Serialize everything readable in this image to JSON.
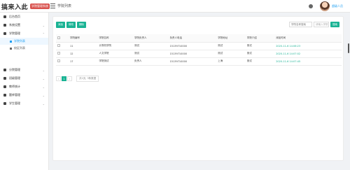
{
  "header": {
    "logo_text": "搞来入此",
    "logo_badge": "学院管理系统",
    "breadcrumb": "学院列表",
    "user_name": "超级人员"
  },
  "sidebar": {
    "items": [
      {
        "label": "后台首页",
        "icon": "home-icon"
      },
      {
        "label": "系统设置",
        "icon": "gear-icon"
      },
      {
        "label": "学院管理",
        "icon": "building-icon"
      },
      {
        "label": "分院管理",
        "icon": "sitemap-icon"
      },
      {
        "label": "班级管理",
        "icon": "users-icon"
      },
      {
        "label": "教师统计",
        "icon": "chart-icon"
      },
      {
        "label": "题库管理",
        "icon": "book-icon"
      },
      {
        "label": "学生管理",
        "icon": "student-icon"
      }
    ],
    "sub_items": [
      {
        "label": "学院列表"
      },
      {
        "label": "校区列表"
      }
    ]
  },
  "toolbar": {
    "add_label": "添加",
    "edit_label": "修改",
    "delete_label": "删除"
  },
  "search": {
    "select_value": "学院名称搜索",
    "input_placeholder": "请输入学院",
    "button_label": "搜索"
  },
  "table": {
    "columns": [
      "学院编号",
      "学院名称",
      "学院负责人",
      "负责人电话",
      "学院地址",
      "学院介绍",
      "添加时间"
    ],
    "rows": [
      [
        "11",
        "计算机学院",
        "测试",
        "15139710000",
        "测试",
        "测试",
        "2020-11-6 14:06:23"
      ],
      [
        "12",
        "人文学院",
        "测试",
        "15139710000",
        "测试",
        "测试",
        "2020-11-6 14:07:02"
      ],
      [
        "17",
        "学院测试",
        "负责人",
        "15139710000",
        "上海",
        "测试",
        "2020-11-6 14:07:45"
      ]
    ]
  },
  "pager": {
    "prev": "‹",
    "current": "1",
    "next": "›",
    "info": "共1页, 3条数据"
  },
  "colors": {
    "accent": "#1ab394",
    "link": "#1e9ff2"
  }
}
